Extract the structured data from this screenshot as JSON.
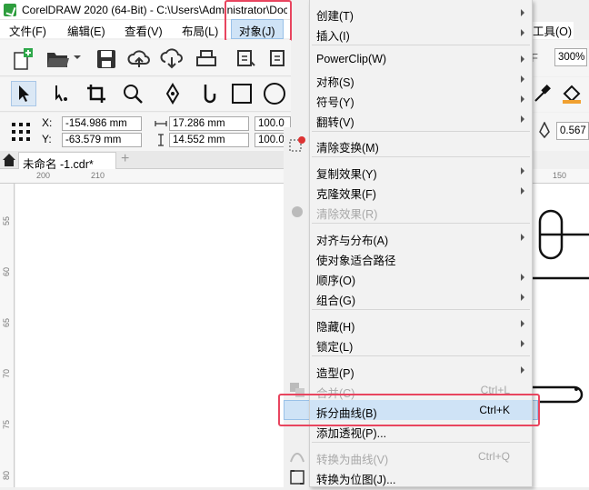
{
  "title": "CorelDRAW 2020 (64-Bit) - C:\\Users\\Administrator\\Doc",
  "menubar": {
    "items": [
      "文件(F)",
      "编辑(E)",
      "查看(V)",
      "布局(L)",
      "对象(J)"
    ],
    "tools": "工具(O)"
  },
  "toolbar": {
    "zoom": "300%"
  },
  "property_bar": {
    "x_label": "X:",
    "x_value": "-154.986 mm",
    "y_label": "Y:",
    "y_value": "-63.579 mm",
    "w_value": "17.286 mm",
    "h_value": "14.552 mm",
    "sx_value": "100.0",
    "sy_value": "100.0",
    "outline_value": "0.567"
  },
  "tabs": {
    "doc": "未命名 -1.cdr*",
    "add": "+"
  },
  "ruler": {
    "top": [
      "200",
      "210"
    ],
    "top_right": "150",
    "left": [
      "55",
      "60",
      "65",
      "70",
      "75",
      "80"
    ]
  },
  "dropdown": {
    "items": [
      {
        "label": "创建(T)",
        "submenu": true,
        "disabled": false
      },
      {
        "label": "插入(I)",
        "submenu": true,
        "disabled": false
      },
      {
        "label": "PowerClip(W)",
        "submenu": true,
        "disabled": false
      },
      {
        "label": "对称(S)",
        "submenu": true,
        "disabled": false
      },
      {
        "label": "符号(Y)",
        "submenu": true,
        "disabled": false
      },
      {
        "label": "翻转(V)",
        "submenu": true,
        "disabled": false
      },
      {
        "label": "清除变换(M)",
        "submenu": false,
        "disabled": false
      },
      {
        "label": "复制效果(Y)",
        "submenu": true,
        "disabled": false
      },
      {
        "label": "克隆效果(F)",
        "submenu": true,
        "disabled": false
      },
      {
        "label": "清除效果(R)",
        "submenu": false,
        "disabled": true
      },
      {
        "label": "对齐与分布(A)",
        "submenu": true,
        "disabled": false
      },
      {
        "label": "使对象适合路径",
        "submenu": false,
        "disabled": false
      },
      {
        "label": "顺序(O)",
        "submenu": true,
        "disabled": false
      },
      {
        "label": "组合(G)",
        "submenu": true,
        "disabled": false
      },
      {
        "label": "隐藏(H)",
        "submenu": true,
        "disabled": false
      },
      {
        "label": "锁定(L)",
        "submenu": true,
        "disabled": false
      },
      {
        "label": "造型(P)",
        "submenu": true,
        "disabled": false
      },
      {
        "label": "合并(C)",
        "shortcut": "Ctrl+L",
        "submenu": false,
        "disabled": true
      },
      {
        "label": "拆分曲线(B)",
        "shortcut": "Ctrl+K",
        "submenu": false,
        "disabled": false,
        "highlighted": true
      },
      {
        "label": "添加透视(P)...",
        "submenu": false,
        "disabled": false
      },
      {
        "label": "转换为曲线(V)",
        "shortcut": "Ctrl+Q",
        "submenu": false,
        "disabled": true
      },
      {
        "label": "转换为位图(J)...",
        "submenu": false,
        "disabled": false
      }
    ]
  },
  "colors": {
    "highlight": "#cfe3f6",
    "annotation": "#e8455f",
    "logo": "#2e9e3e"
  }
}
